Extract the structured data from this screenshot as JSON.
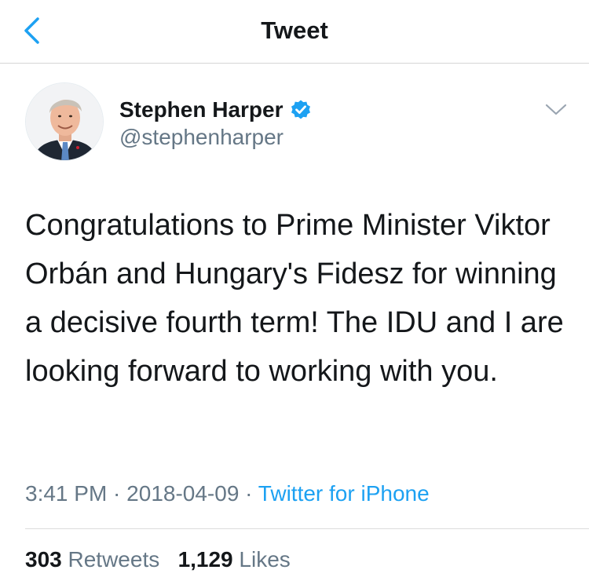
{
  "nav": {
    "title": "Tweet",
    "back_icon": "chevron-left-icon",
    "accent_color": "#1da1f2"
  },
  "tweet": {
    "display_name": "Stephen Harper",
    "verified": true,
    "handle": "@stephenharper",
    "text": "Congratulations to Prime Minister Viktor Orbán and Hungary's Fidesz for winning a decisive fourth term! The IDU and I are looking forward to working with you.",
    "time": "3:41 PM",
    "separator": " · ",
    "date": "2018-04-09",
    "source": "Twitter for iPhone",
    "retweets_count": "303",
    "retweets_label": "Retweets",
    "likes_count": "1,129",
    "likes_label": "Likes"
  },
  "colors": {
    "text": "#14171a",
    "secondary": "#657786",
    "link": "#1da1f2",
    "verified_badge": "#1da1f2"
  }
}
